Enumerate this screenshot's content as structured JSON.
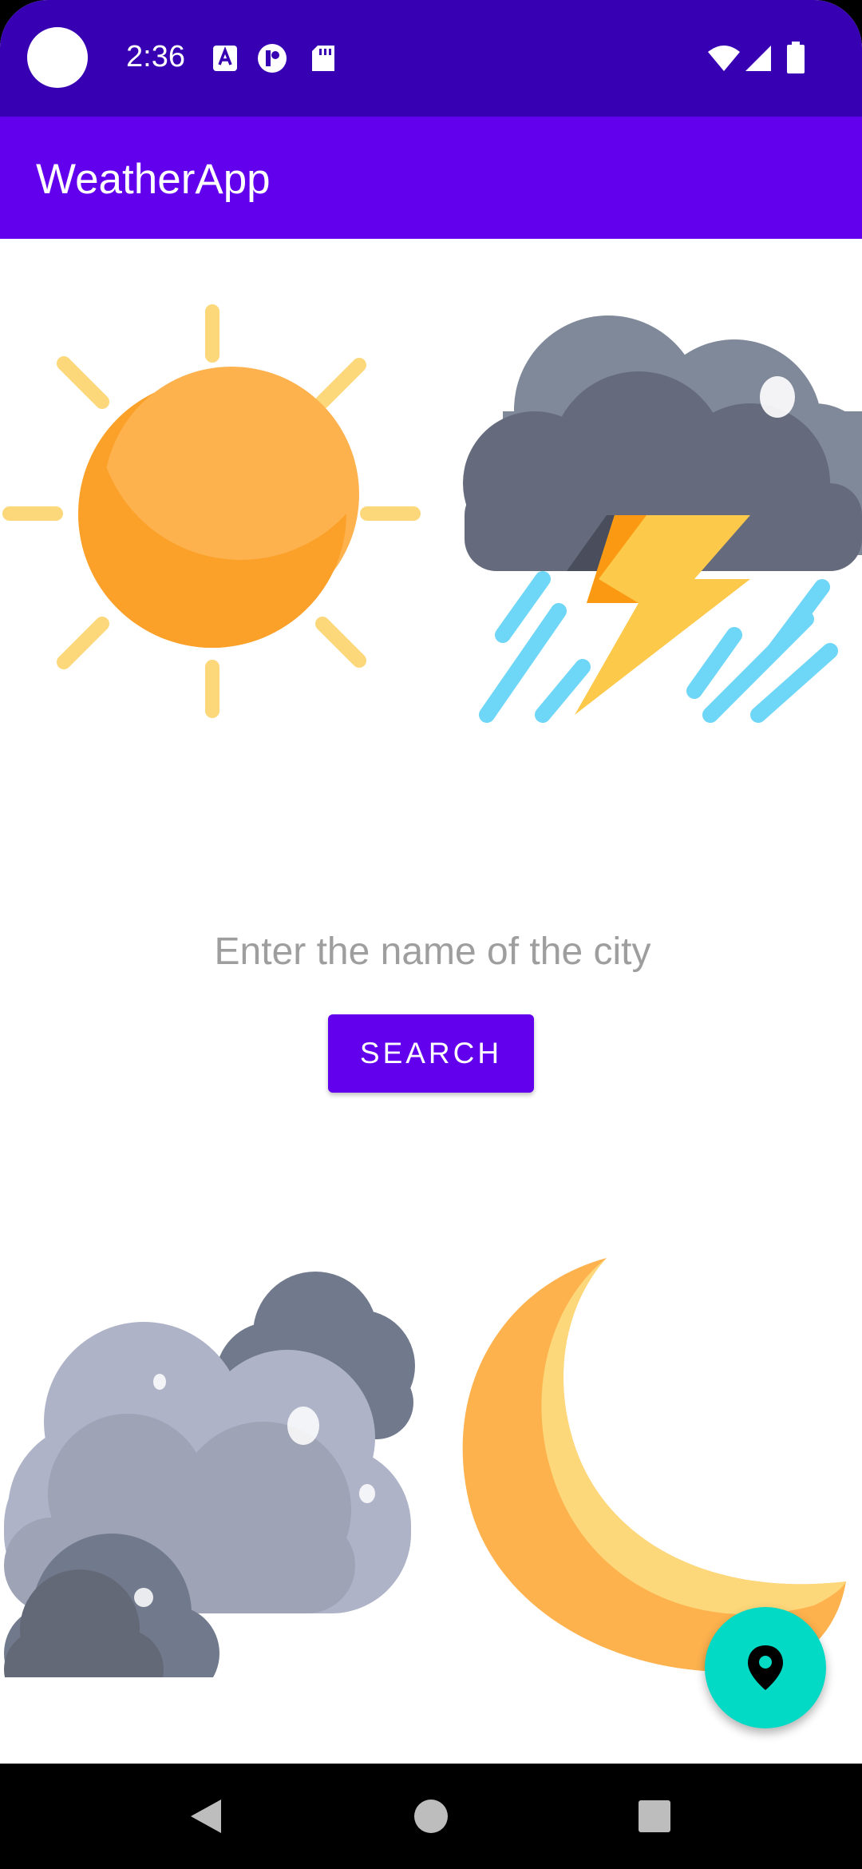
{
  "status_bar": {
    "time": "2:36",
    "icons": [
      "camera-cutout",
      "a-notification-icon",
      "p-notification-icon",
      "sd-card-icon",
      "wifi-icon",
      "signal-icon",
      "battery-icon"
    ]
  },
  "app_bar": {
    "title": "WeatherApp"
  },
  "city_input": {
    "placeholder": "Enter the name of the city",
    "value": ""
  },
  "search_button": {
    "label": "SEARCH"
  },
  "illustrations": [
    "sun-icon",
    "storm-cloud-icon",
    "clouds-icon",
    "moon-icon"
  ],
  "fab": {
    "icon": "location-pin-icon"
  },
  "nav_bar": {
    "buttons": [
      "back-icon",
      "home-icon",
      "recents-icon"
    ]
  },
  "colors": {
    "status": "#3700b3",
    "primary": "#6200ee",
    "accent": "#03dac5"
  }
}
